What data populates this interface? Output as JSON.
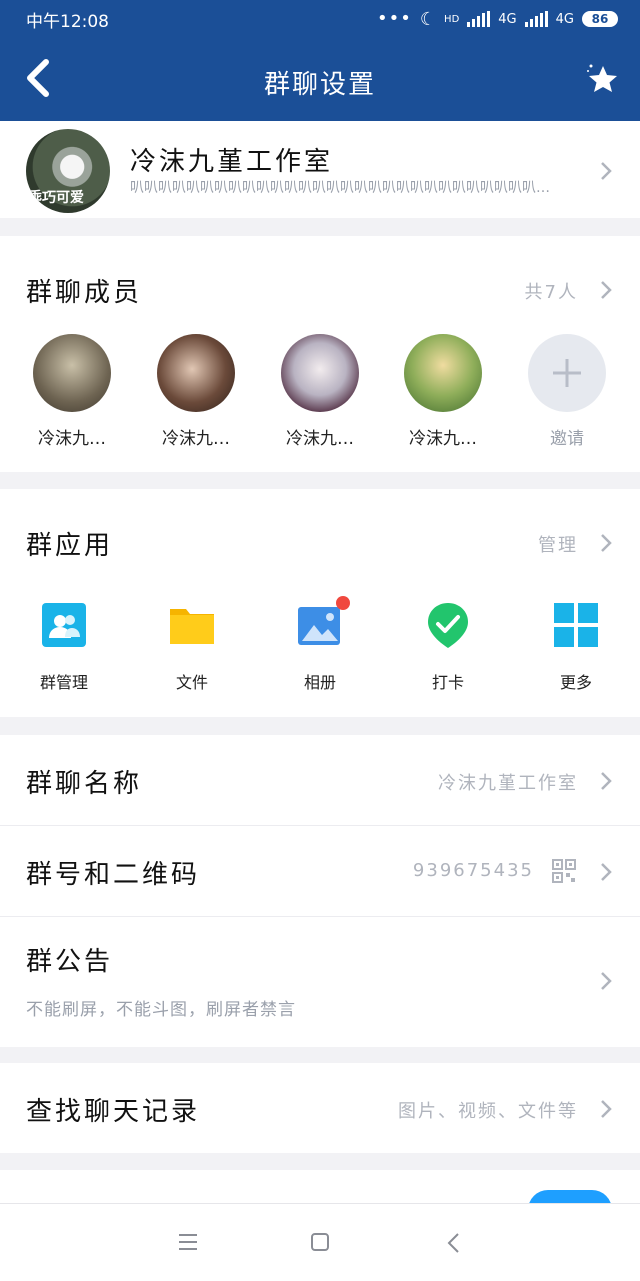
{
  "status_bar": {
    "time": "中午12:08",
    "hd_label": "HD",
    "net1": "4G",
    "net2": "4G",
    "battery": "86"
  },
  "header": {
    "title": "群聊设置"
  },
  "group": {
    "name": "冷沫九堇工作室",
    "description": "叭叭叭叭叭叭叭叭叭叭叭叭叭叭叭叭叭叭叭叭叭叭叭叭叭叭叭叭叭…",
    "avatar_text": "乖巧可爱"
  },
  "members": {
    "title": "群聊成员",
    "count_text": "共7人",
    "list": [
      {
        "name": "冷沫九…"
      },
      {
        "name": "冷沫九…"
      },
      {
        "name": "冷沫九…"
      },
      {
        "name": "冷沫九…"
      }
    ],
    "invite_label": "邀请"
  },
  "apps": {
    "title": "群应用",
    "manage_label": "管理",
    "list": [
      {
        "label": "群管理",
        "icon": "group-manage-icon"
      },
      {
        "label": "文件",
        "icon": "folder-icon"
      },
      {
        "label": "相册",
        "icon": "album-icon"
      },
      {
        "label": "打卡",
        "icon": "checkin-icon"
      },
      {
        "label": "更多",
        "icon": "grid-icon"
      }
    ]
  },
  "settings": {
    "group_name_label": "群聊名称",
    "group_name_value": "冷沫九堇工作室",
    "group_number_label": "群号和二维码",
    "group_number_value": "939675435",
    "announcement_label": "群公告",
    "announcement_text": "不能刷屏，不能斗图，刷屏者禁言",
    "search_history_label": "查找聊天记录",
    "search_history_hint": "图片、视频、文件等"
  },
  "colors": {
    "header_bg": "#1b4f97",
    "toggle_on": "#1e9fff",
    "muted_text": "#b0b4bd",
    "checkin_green": "#2ecc71",
    "badge_red": "#f0483e"
  }
}
